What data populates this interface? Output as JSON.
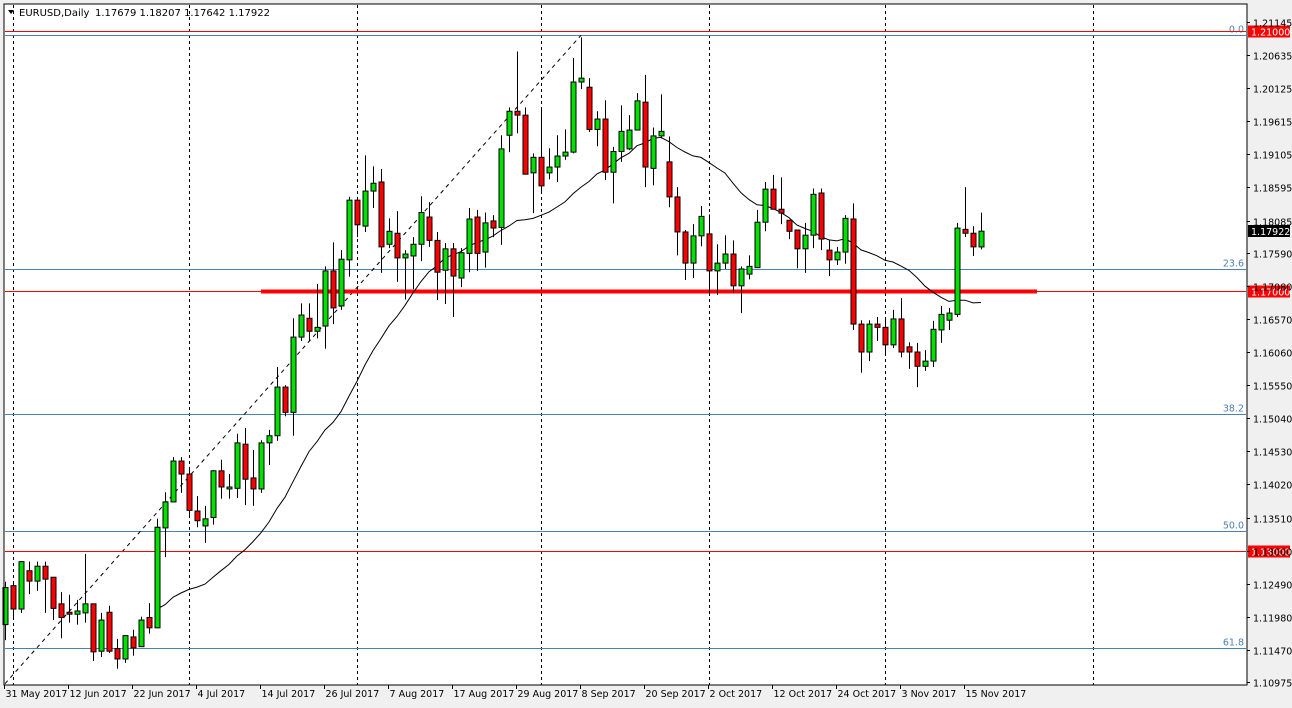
{
  "header": {
    "symbol": "EURUSD,Daily",
    "ohlc_text": "1.17679 1.18207 1.17642 1.17922"
  },
  "colors": {
    "bull": "#00e000",
    "bear": "#ff0000",
    "fib": "#4682b4",
    "level": "#ff0000",
    "ma": "#000000",
    "grid": "#000000"
  },
  "chart_data": {
    "type": "candlestick",
    "title": "EURUSD,Daily",
    "ylim": [
      1.10975,
      1.21145
    ],
    "y_ticks": [
      "1.21145",
      "1.20635",
      "1.20125",
      "1.19615",
      "1.19105",
      "1.18595",
      "1.18085",
      "1.17590",
      "1.17080",
      "1.16570",
      "1.16060",
      "1.15550",
      "1.15040",
      "1.14530",
      "1.14020",
      "1.13510",
      "1.13000",
      "1.12490",
      "1.11980",
      "1.11470",
      "1.10975"
    ],
    "x_labels": [
      {
        "bar": 0,
        "label": "31 May 2017"
      },
      {
        "bar": 8,
        "label": "12 Jun 2017"
      },
      {
        "bar": 16,
        "label": "22 Jun 2017"
      },
      {
        "bar": 24,
        "label": "4 Jul 2017"
      },
      {
        "bar": 32,
        "label": "14 Jul 2017"
      },
      {
        "bar": 40,
        "label": "26 Jul 2017"
      },
      {
        "bar": 48,
        "label": "7 Aug 2017"
      },
      {
        "bar": 56,
        "label": "17 Aug 2017"
      },
      {
        "bar": 64,
        "label": "29 Aug 2017"
      },
      {
        "bar": 72,
        "label": "8 Sep 2017"
      },
      {
        "bar": 80,
        "label": "20 Sep 2017"
      },
      {
        "bar": 88,
        "label": "2 Oct 2017"
      },
      {
        "bar": 96,
        "label": "12 Oct 2017"
      },
      {
        "bar": 104,
        "label": "24 Oct 2017"
      },
      {
        "bar": 112,
        "label": "3 Nov 2017"
      },
      {
        "bar": 120,
        "label": "15 Nov 2017"
      }
    ],
    "vertical_grid_bars": [
      1,
      23,
      44,
      67,
      88,
      110,
      136
    ],
    "ohlc_fields": [
      "open",
      "high",
      "low",
      "close"
    ],
    "candles": [
      [
        1.1186,
        1.1252,
        1.1162,
        1.1243
      ],
      [
        1.1246,
        1.1252,
        1.1193,
        1.121
      ],
      [
        1.121,
        1.1284,
        1.1204,
        1.1283
      ],
      [
        1.1269,
        1.1283,
        1.1233,
        1.1253
      ],
      [
        1.1253,
        1.1283,
        1.1238,
        1.1276
      ],
      [
        1.1276,
        1.1283,
        1.1204,
        1.1256
      ],
      [
        1.1259,
        1.1259,
        1.1193,
        1.1211
      ],
      [
        1.1218,
        1.1236,
        1.1165,
        1.1197
      ],
      [
        1.1205,
        1.1232,
        1.1189,
        1.1202
      ],
      [
        1.1202,
        1.1224,
        1.1186,
        1.1207
      ],
      [
        1.1204,
        1.1295,
        1.1189,
        1.1218
      ],
      [
        1.1218,
        1.1218,
        1.113,
        1.1144
      ],
      [
        1.1145,
        1.1204,
        1.1136,
        1.1193
      ],
      [
        1.1205,
        1.1215,
        1.1142,
        1.1145
      ],
      [
        1.1149,
        1.1164,
        1.1118,
        1.1133
      ],
      [
        1.1133,
        1.1169,
        1.1127,
        1.1169
      ],
      [
        1.1167,
        1.1178,
        1.1138,
        1.115
      ],
      [
        1.1152,
        1.1198,
        1.1152,
        1.1193
      ],
      [
        1.1197,
        1.1219,
        1.1172,
        1.1181
      ],
      [
        1.1181,
        1.1349,
        1.1181,
        1.1336
      ],
      [
        1.1335,
        1.139,
        1.129,
        1.1375
      ],
      [
        1.1375,
        1.1444,
        1.1375,
        1.1438
      ],
      [
        1.1438,
        1.1444,
        1.1389,
        1.1418
      ],
      [
        1.1418,
        1.1429,
        1.1355,
        1.1362
      ],
      [
        1.1361,
        1.1384,
        1.1336,
        1.1346
      ],
      [
        1.1338,
        1.1369,
        1.1312,
        1.1349
      ],
      [
        1.1351,
        1.1424,
        1.134,
        1.1423
      ],
      [
        1.1423,
        1.144,
        1.138,
        1.1398
      ],
      [
        1.1395,
        1.1418,
        1.138,
        1.1398
      ],
      [
        1.1396,
        1.148,
        1.1381,
        1.1466
      ],
      [
        1.1464,
        1.1489,
        1.137,
        1.141
      ],
      [
        1.1412,
        1.1455,
        1.1369,
        1.1395
      ],
      [
        1.1395,
        1.147,
        1.1389,
        1.1466
      ],
      [
        1.1466,
        1.1486,
        1.1432,
        1.1477
      ],
      [
        1.1477,
        1.1583,
        1.1469,
        1.1552
      ],
      [
        1.1552,
        1.1555,
        1.1507,
        1.1513
      ],
      [
        1.1513,
        1.1658,
        1.1477,
        1.1629
      ],
      [
        1.1629,
        1.1681,
        1.1623,
        1.1663
      ],
      [
        1.1658,
        1.1681,
        1.1623,
        1.1638
      ],
      [
        1.1638,
        1.1711,
        1.1627,
        1.1644
      ],
      [
        1.1646,
        1.1738,
        1.1611,
        1.1731
      ],
      [
        1.1731,
        1.1775,
        1.1649,
        1.1674
      ],
      [
        1.1677,
        1.1763,
        1.1671,
        1.1749
      ],
      [
        1.1748,
        1.1845,
        1.1722,
        1.184
      ],
      [
        1.184,
        1.1845,
        1.1783,
        1.1802
      ],
      [
        1.18,
        1.1909,
        1.1791,
        1.1854
      ],
      [
        1.1854,
        1.1892,
        1.1828,
        1.1866
      ],
      [
        1.1868,
        1.1888,
        1.1728,
        1.1768
      ],
      [
        1.1772,
        1.1812,
        1.1766,
        1.1792
      ],
      [
        1.1789,
        1.1823,
        1.1714,
        1.1751
      ],
      [
        1.1751,
        1.1763,
        1.1687,
        1.1757
      ],
      [
        1.1754,
        1.1783,
        1.1703,
        1.1772
      ],
      [
        1.1772,
        1.1846,
        1.1746,
        1.1821
      ],
      [
        1.1814,
        1.1837,
        1.1768,
        1.1778
      ],
      [
        1.1778,
        1.1791,
        1.1686,
        1.1729
      ],
      [
        1.1732,
        1.1774,
        1.168,
        1.1765
      ],
      [
        1.1765,
        1.1774,
        1.166,
        1.1723
      ],
      [
        1.172,
        1.1766,
        1.1706,
        1.1759
      ],
      [
        1.1758,
        1.1828,
        1.1729,
        1.1811
      ],
      [
        1.1814,
        1.1825,
        1.1731,
        1.1758
      ],
      [
        1.176,
        1.1821,
        1.1736,
        1.1805
      ],
      [
        1.1808,
        1.1817,
        1.1783,
        1.1797
      ],
      [
        1.1798,
        1.194,
        1.1771,
        1.1919
      ],
      [
        1.194,
        1.1983,
        1.1914,
        1.1977
      ],
      [
        1.1977,
        1.2069,
        1.1943,
        1.1971
      ],
      [
        1.1971,
        1.1983,
        1.188,
        1.188
      ],
      [
        1.1882,
        1.1912,
        1.182,
        1.1906
      ],
      [
        1.1906,
        1.1979,
        1.1851,
        1.1862
      ],
      [
        1.1882,
        1.192,
        1.1872,
        1.1891
      ],
      [
        1.1891,
        1.194,
        1.1868,
        1.1908
      ],
      [
        1.1908,
        1.1949,
        1.1902,
        1.1914
      ],
      [
        1.1914,
        1.2059,
        1.1912,
        1.2022
      ],
      [
        1.2022,
        1.2091,
        1.2011,
        1.2028
      ],
      [
        1.2014,
        1.2028,
        1.1945,
        1.1949
      ],
      [
        1.1949,
        1.1977,
        1.1923,
        1.1965
      ],
      [
        1.1965,
        1.1994,
        1.1871,
        1.1883
      ],
      [
        1.1883,
        1.1922,
        1.1835,
        1.1915
      ],
      [
        1.1915,
        1.1986,
        1.1899,
        1.1946
      ],
      [
        1.1919,
        1.1971,
        1.1917,
        1.1948
      ],
      [
        1.1948,
        1.2005,
        1.1948,
        1.1993
      ],
      [
        1.1991,
        1.2033,
        1.186,
        1.1891
      ],
      [
        1.1889,
        1.1952,
        1.1863,
        1.1939
      ],
      [
        1.1939,
        1.2003,
        1.1935,
        1.1946
      ],
      [
        1.1899,
        1.1938,
        1.1829,
        1.1845
      ],
      [
        1.1845,
        1.186,
        1.1755,
        1.1791
      ],
      [
        1.1791,
        1.1794,
        1.1717,
        1.1743
      ],
      [
        1.1743,
        1.1803,
        1.172,
        1.1785
      ],
      [
        1.1785,
        1.1831,
        1.1769,
        1.1815
      ],
      [
        1.1788,
        1.1818,
        1.1694,
        1.1731
      ],
      [
        1.1731,
        1.1772,
        1.1694,
        1.1743
      ],
      [
        1.1743,
        1.1786,
        1.1734,
        1.1757
      ],
      [
        1.1757,
        1.1778,
        1.1697,
        1.1708
      ],
      [
        1.1708,
        1.1738,
        1.1666,
        1.1734
      ],
      [
        1.1726,
        1.1755,
        1.1718,
        1.1738
      ],
      [
        1.1736,
        1.1825,
        1.1736,
        1.1806
      ],
      [
        1.1806,
        1.1868,
        1.1792,
        1.1857
      ],
      [
        1.1857,
        1.1879,
        1.1826,
        1.1826
      ],
      [
        1.1826,
        1.1875,
        1.1803,
        1.182
      ],
      [
        1.1809,
        1.1809,
        1.178,
        1.1792
      ],
      [
        1.1794,
        1.1794,
        1.1735,
        1.1765
      ],
      [
        1.1765,
        1.1805,
        1.1728,
        1.1786
      ],
      [
        1.1786,
        1.1858,
        1.1766,
        1.1849
      ],
      [
        1.1851,
        1.1858,
        1.1763,
        1.178
      ],
      [
        1.1763,
        1.1778,
        1.1723,
        1.1748
      ],
      [
        1.1748,
        1.1768,
        1.174,
        1.176
      ],
      [
        1.176,
        1.1817,
        1.1742,
        1.1812
      ],
      [
        1.1811,
        1.1835,
        1.164,
        1.1649
      ],
      [
        1.1649,
        1.1655,
        1.1574,
        1.1606
      ],
      [
        1.1606,
        1.1655,
        1.1592,
        1.1649
      ],
      [
        1.1649,
        1.166,
        1.1623,
        1.1644
      ],
      [
        1.1644,
        1.166,
        1.1601,
        1.1617
      ],
      [
        1.1617,
        1.1671,
        1.1612,
        1.1657
      ],
      [
        1.1657,
        1.1689,
        1.1598,
        1.1606
      ],
      [
        1.1614,
        1.1621,
        1.158,
        1.1606
      ],
      [
        1.1606,
        1.162,
        1.1552,
        1.1584
      ],
      [
        1.1584,
        1.1609,
        1.1577,
        1.1592
      ],
      [
        1.1592,
        1.1654,
        1.1583,
        1.1641
      ],
      [
        1.164,
        1.1677,
        1.162,
        1.1664
      ],
      [
        1.1655,
        1.1674,
        1.164,
        1.1666
      ],
      [
        1.1664,
        1.1805,
        1.166,
        1.1797
      ],
      [
        1.1795,
        1.186,
        1.1783,
        1.1789
      ],
      [
        1.1789,
        1.18,
        1.1754,
        1.1768
      ],
      [
        1.17679,
        1.18207,
        1.17642,
        1.17922
      ]
    ],
    "moving_average": {
      "type": "SMA",
      "period": 20
    },
    "horizontal_levels": [
      {
        "price": 1.21,
        "label": "1.21000",
        "thick_from_bar": null,
        "thick_to_bar": null
      },
      {
        "price": 1.17,
        "label": "1.17000",
        "thick_from_bar": 32,
        "thick_to_bar": 129
      },
      {
        "price": 1.13,
        "label": "1.13000",
        "thick_from_bar": null,
        "thick_to_bar": null
      }
    ],
    "current_price": {
      "price": 1.17922,
      "label": "1.17922"
    },
    "fibonacci": {
      "high": 1.2094,
      "low": 1.0567,
      "levels": [
        {
          "ratio": 0.0,
          "label": "0.0"
        },
        {
          "ratio": 0.236,
          "label": "23.6"
        },
        {
          "ratio": 0.382,
          "label": "38.2"
        },
        {
          "ratio": 0.5,
          "label": "50.0"
        },
        {
          "ratio": 0.618,
          "label": "61.8"
        }
      ],
      "trendline": {
        "from_bar": 0,
        "from_price": 1.1095,
        "to_bar": 72,
        "to_price": 1.2094
      }
    }
  }
}
